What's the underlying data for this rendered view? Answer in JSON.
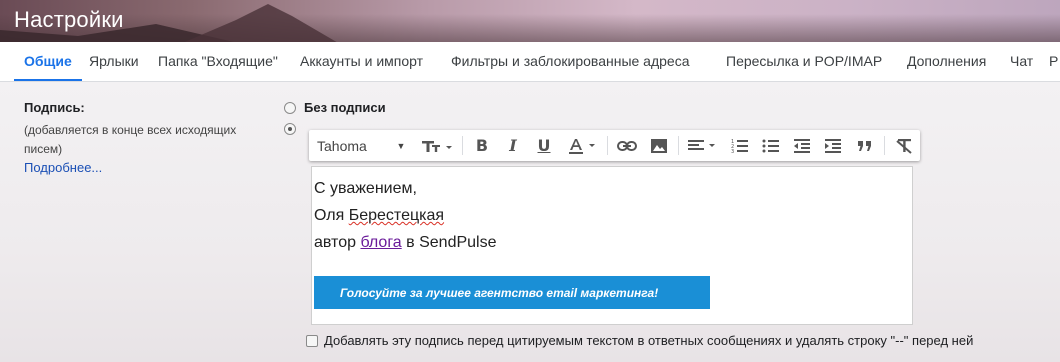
{
  "header": {
    "title": "Настройки"
  },
  "tabs": [
    {
      "label": "Общие"
    },
    {
      "label": "Ярлыки"
    },
    {
      "label": "Папка \"Входящие\""
    },
    {
      "label": "Аккаунты и импорт"
    },
    {
      "label": "Фильтры и заблокированные адреса"
    },
    {
      "label": "Пересылка и POP/IMAP"
    },
    {
      "label": "Дополнения"
    },
    {
      "label": "Чат"
    },
    {
      "label": "Р"
    }
  ],
  "signature": {
    "label": "Подпись:",
    "sublabel": "(добавляется в конце всех исходящих писем)",
    "learn_more": "Подробнее...",
    "no_signature": "Без подписи",
    "toolbar": {
      "font": "Tahoma"
    },
    "body": {
      "line1": "С уважением,",
      "line2_first": "Оля",
      "line2_last": "Берестецкая",
      "line3_prefix": "автор",
      "line3_link": "блога",
      "line3_suffix": "в SendPulse",
      "banner": "Голосуйте за лучшее агентство email маркетинга!"
    },
    "checkbox_label": "Добавлять эту подпись перед цитируемым текстом в ответных сообщениях и удалять строку \"--\" перед ней"
  },
  "colors": {
    "accent": "#1a73e8",
    "banner": "#1a8fd6",
    "link": "#6a1b9a"
  }
}
